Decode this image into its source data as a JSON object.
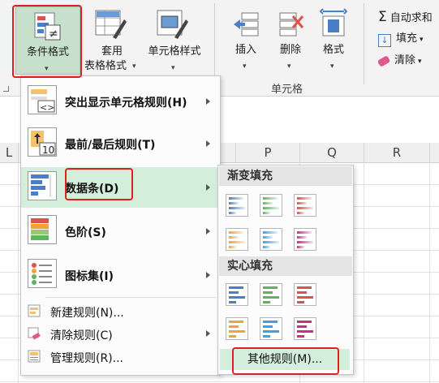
{
  "ribbon": {
    "conditional_format": "条件格式",
    "table_format_line1": "套用",
    "table_format_line2": "表格格式",
    "cell_style": "单元格样式",
    "insert": "插入",
    "delete": "删除",
    "format": "格式",
    "group_cells": "单元格",
    "autosum": "自动求和",
    "fill": "填充",
    "clear": "清除"
  },
  "columns": [
    "L",
    "P",
    "Q",
    "R"
  ],
  "menu": {
    "items": [
      {
        "label": "突出显示单元格规则(H)"
      },
      {
        "label": "最前/最后规则(T)"
      },
      {
        "label": "数据条(D)"
      },
      {
        "label": "色阶(S)"
      },
      {
        "label": "图标集(I)"
      },
      {
        "label": "新建规则(N)..."
      },
      {
        "label": "清除规则(C)"
      },
      {
        "label": "管理规则(R)..."
      }
    ],
    "top_bottom_icon_text": "10"
  },
  "submenu": {
    "gradient_header": "渐变填充",
    "solid_header": "实心填充",
    "more_rules": "其他规则(M)..."
  },
  "colors": {
    "blue": "#4a7fc8",
    "green": "#5fb25f",
    "red": "#d9534f",
    "orange": "#f2a236",
    "lightblue": "#3aa0e8",
    "magenta": "#cc2d8a",
    "highlight": "#d4eedc",
    "annotation": "#e02020"
  }
}
